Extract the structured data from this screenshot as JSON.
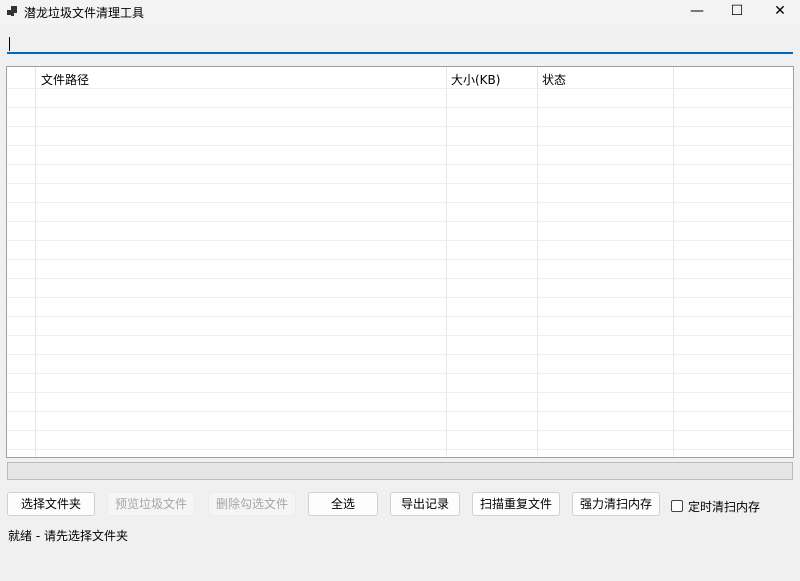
{
  "window": {
    "title": "潜龙垃圾文件清理工具",
    "minimize": "—",
    "maximize": "☐",
    "close": "✕"
  },
  "path_input": {
    "value": ""
  },
  "table": {
    "columns": [
      "文件路径",
      "大小(KB)",
      "状态",
      ""
    ],
    "rows": []
  },
  "progress": {
    "value": 0
  },
  "buttons": [
    {
      "label": "选择文件夹",
      "enabled": true
    },
    {
      "label": "预览垃圾文件",
      "enabled": false
    },
    {
      "label": "删除勾选文件",
      "enabled": false
    },
    {
      "label": "全选",
      "enabled": true
    },
    {
      "label": "导出记录",
      "enabled": true
    },
    {
      "label": "扫描重复文件",
      "enabled": true
    },
    {
      "label": "强力清扫内存",
      "enabled": true
    }
  ],
  "timer_checkbox": {
    "label": "定时清扫内存",
    "checked": false
  },
  "status_text": "就绪 - 请先选择文件夹"
}
